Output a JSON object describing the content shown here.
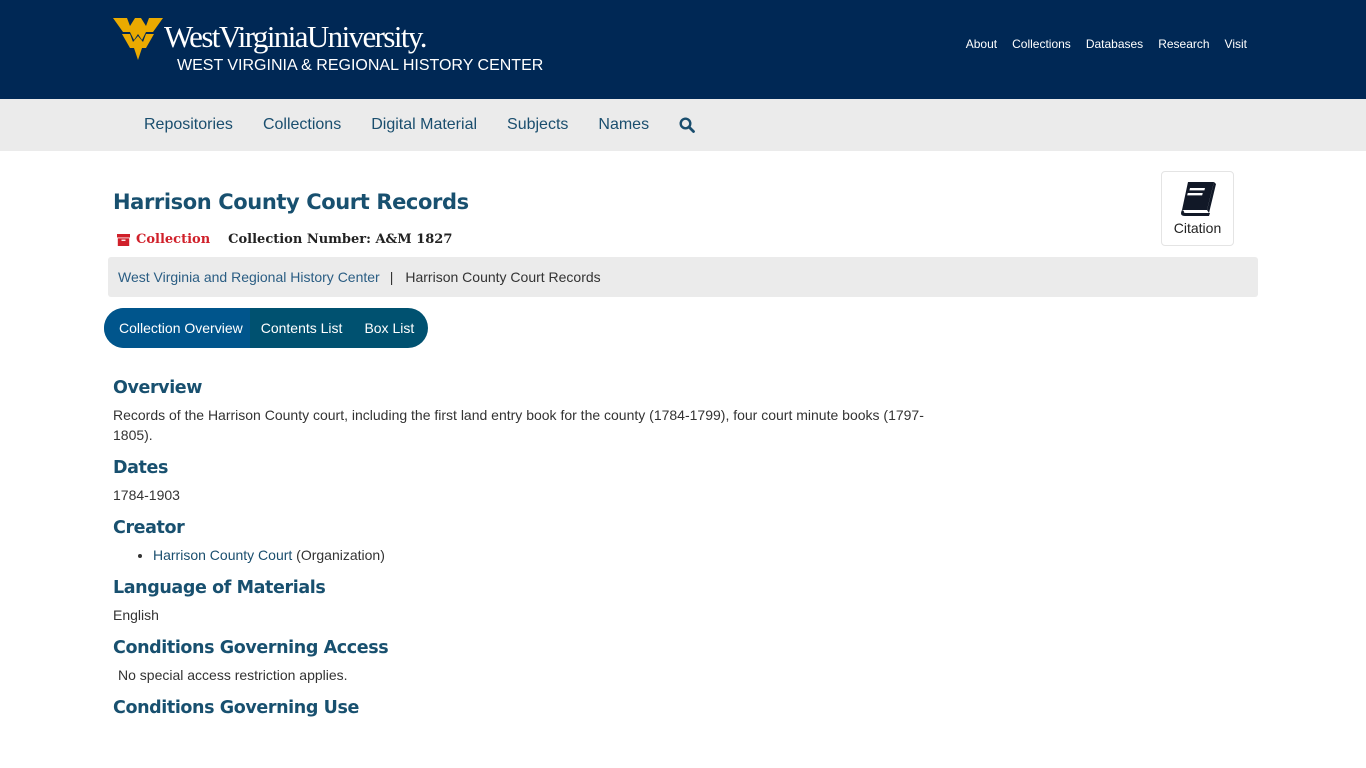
{
  "header": {
    "university": "WestVirginiaUniversity.",
    "subtitle": "WEST VIRGINIA & REGIONAL HISTORY CENTER",
    "brand_colors": {
      "navy": "#002855",
      "gold": "#EAAA00"
    },
    "top_links": [
      "About",
      "Collections",
      "Databases",
      "Research",
      "Visit"
    ]
  },
  "navbar": {
    "items": [
      "Repositories",
      "Collections",
      "Digital Material",
      "Subjects",
      "Names"
    ],
    "search_icon": "search-icon"
  },
  "record": {
    "title": "Harrison County Court Records",
    "type_icon": "archive-box-icon",
    "type_label": "Collection",
    "collection_number": "Collection Number: A&M 1827",
    "citation_label": "Citation",
    "citation_icon": "book-icon"
  },
  "breadcrumb": {
    "items": [
      "West Virginia and Regional History Center",
      "Harrison County Court Records"
    ],
    "separator": "|"
  },
  "tabs": {
    "items": [
      "Collection Overview",
      "Contents List",
      "Box List"
    ],
    "active": "Collection Overview"
  },
  "sections": {
    "overview": {
      "heading": "Overview",
      "text": "Records of the Harrison County court, including the first land entry book for the county (1784-1799), four court minute books (1797-1805)."
    },
    "dates": {
      "heading": "Dates",
      "text": "1784-1903"
    },
    "creator": {
      "heading": "Creator",
      "name": "Harrison County Court",
      "role": " (Organization)"
    },
    "language": {
      "heading": "Language of Materials",
      "text": "English"
    },
    "access": {
      "heading": "Conditions Governing Access",
      "text": "No special access restriction applies."
    },
    "use": {
      "heading": "Conditions Governing Use"
    }
  }
}
